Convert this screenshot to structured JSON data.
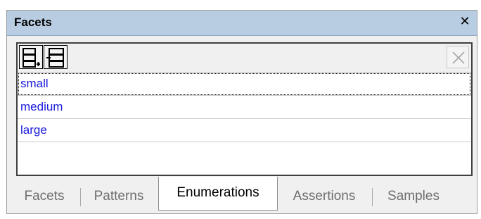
{
  "window": {
    "title": "Facets",
    "close_glyph": "✕"
  },
  "toolbar": {
    "buttons": [
      {
        "name": "append-enumeration",
        "icon": "append-row-icon"
      },
      {
        "name": "insert-enumeration",
        "icon": "insert-row-icon"
      },
      {
        "name": "delete-enumeration",
        "icon": "delete-icon"
      }
    ]
  },
  "enumerations": {
    "items": [
      "small",
      "medium",
      "large",
      ""
    ],
    "selected_index": 0
  },
  "tabs": {
    "items": [
      {
        "label": "Facets",
        "active": false
      },
      {
        "label": "Patterns",
        "active": false
      },
      {
        "label": "Enumerations",
        "active": true
      },
      {
        "label": "Assertions",
        "active": false
      },
      {
        "label": "Samples",
        "active": false
      }
    ]
  },
  "colors": {
    "titlebar": "#b9cde2",
    "item_text": "#1a1adc",
    "inactive_tab_text": "#6e6e6e"
  }
}
